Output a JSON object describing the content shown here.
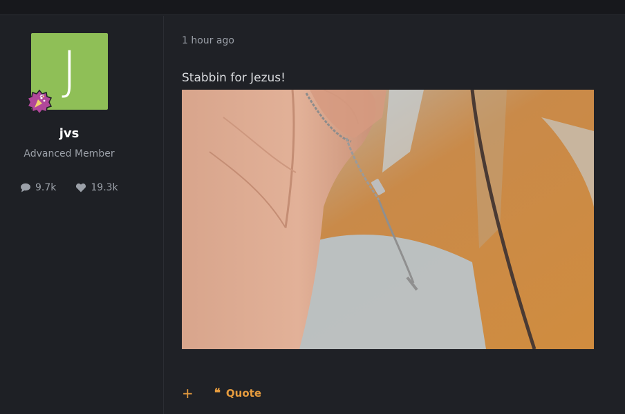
{
  "author": {
    "avatar_letter": "J",
    "avatar_color": "#8fbf57",
    "username": "jvs",
    "rank": "Advanced Member",
    "badge_icon": "party-badge-icon",
    "stats": {
      "comments": "9.7k",
      "likes": "19.3k"
    }
  },
  "post": {
    "timestamp": "1 hour ago",
    "text": "Stabbin for Jezus!",
    "image_alt": "Hand holding a chain pendant in front of a rusty painted surface"
  },
  "actions": {
    "add_label": "+",
    "quote_label": "Quote"
  },
  "colors": {
    "accent": "#e59b3e",
    "background": "#1f2126",
    "sidebar": "#1e2025"
  }
}
